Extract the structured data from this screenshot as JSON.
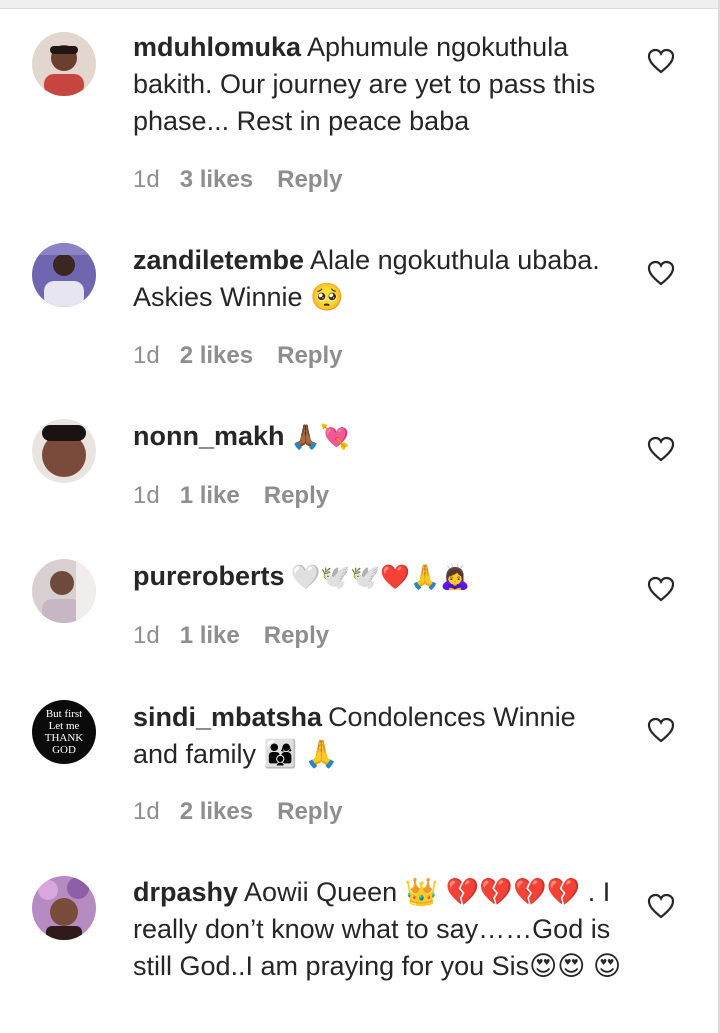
{
  "comments": [
    {
      "username": "mduhlomuka",
      "text": "Aphumule ngokuthula bakith. Our journey are yet to pass this phase... Rest in peace baba",
      "time": "1d",
      "likes": "3 likes",
      "reply": "Reply",
      "avatar_color": "#d9c9c0"
    },
    {
      "username": "zandiletembe",
      "text": "Alale ngokuthula ubaba. Askies Winnie 🥺",
      "time": "1d",
      "likes": "2 likes",
      "reply": "Reply",
      "avatar_color": "#7b6fb5"
    },
    {
      "username": "nonn_makh",
      "text": "🙏🏾💘",
      "time": "1d",
      "likes": "1 like",
      "reply": "Reply",
      "avatar_color": "#8a5a48"
    },
    {
      "username": "pureroberts",
      "text": "🤍🕊️🕊️❤️🙏🙇‍♀️",
      "time": "1d",
      "likes": "1 like",
      "reply": "Reply",
      "avatar_color": "#b89aa0"
    },
    {
      "username": "sindi_mbatsha",
      "text": "Condolences Winnie and family 👨‍👩‍👦 🙏",
      "time": "1d",
      "likes": "2 likes",
      "reply": "Reply",
      "avatar_text": [
        "But first",
        "Let me",
        "THANK GOD"
      ]
    },
    {
      "username": "drpashy",
      "text": "Aowii Queen 👑 💔💔💔💔 . I really don’t know what to say……God is still God..I am praying for you Sis😍😍 😍",
      "avatar_color": "#9a6fa8"
    }
  ],
  "colors": {
    "text": "#262626",
    "meta": "#8e8e8e",
    "background": "#ffffff"
  },
  "icons": {
    "like": "heart-outline-icon"
  }
}
